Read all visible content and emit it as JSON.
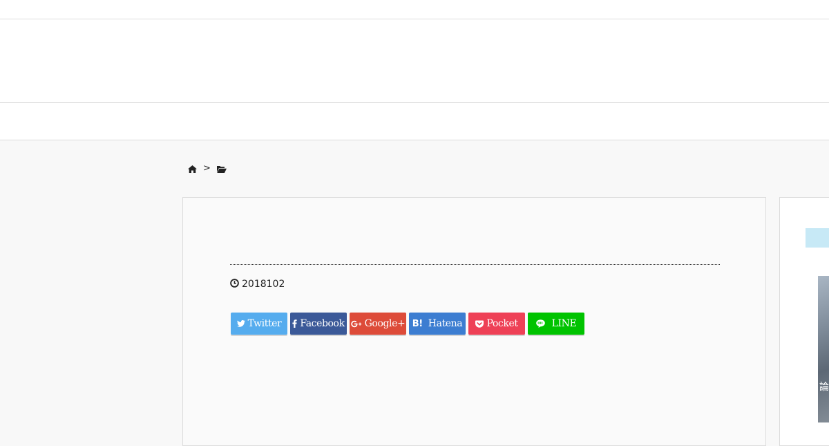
{
  "breadcrumb": {
    "items": [
      {
        "icon": "home-icon"
      },
      {
        "separator": ">"
      },
      {
        "icon": "folder-open-icon"
      }
    ]
  },
  "article": {
    "date_icon": "clock-icon",
    "date": "2018102"
  },
  "share_buttons": [
    {
      "label": "Twitter",
      "icon": "twitter-icon",
      "color": "#55acee"
    },
    {
      "label": "Facebook",
      "icon": "facebook-icon",
      "color": "#3b5998"
    },
    {
      "label": "Google+",
      "icon": "google-plus-icon",
      "color": "#dd4b39"
    },
    {
      "label": "Hatena",
      "icon": "hatena-icon",
      "icon_text": "B!",
      "color": "#3c7dd1"
    },
    {
      "label": "Pocket",
      "icon": "pocket-icon",
      "color": "#ee4056"
    },
    {
      "label": "LINE",
      "icon": "line-icon",
      "color": "#00c300"
    }
  ],
  "sidebar": {
    "tab_color": "#c7e9f6",
    "thumb_text": "論"
  }
}
